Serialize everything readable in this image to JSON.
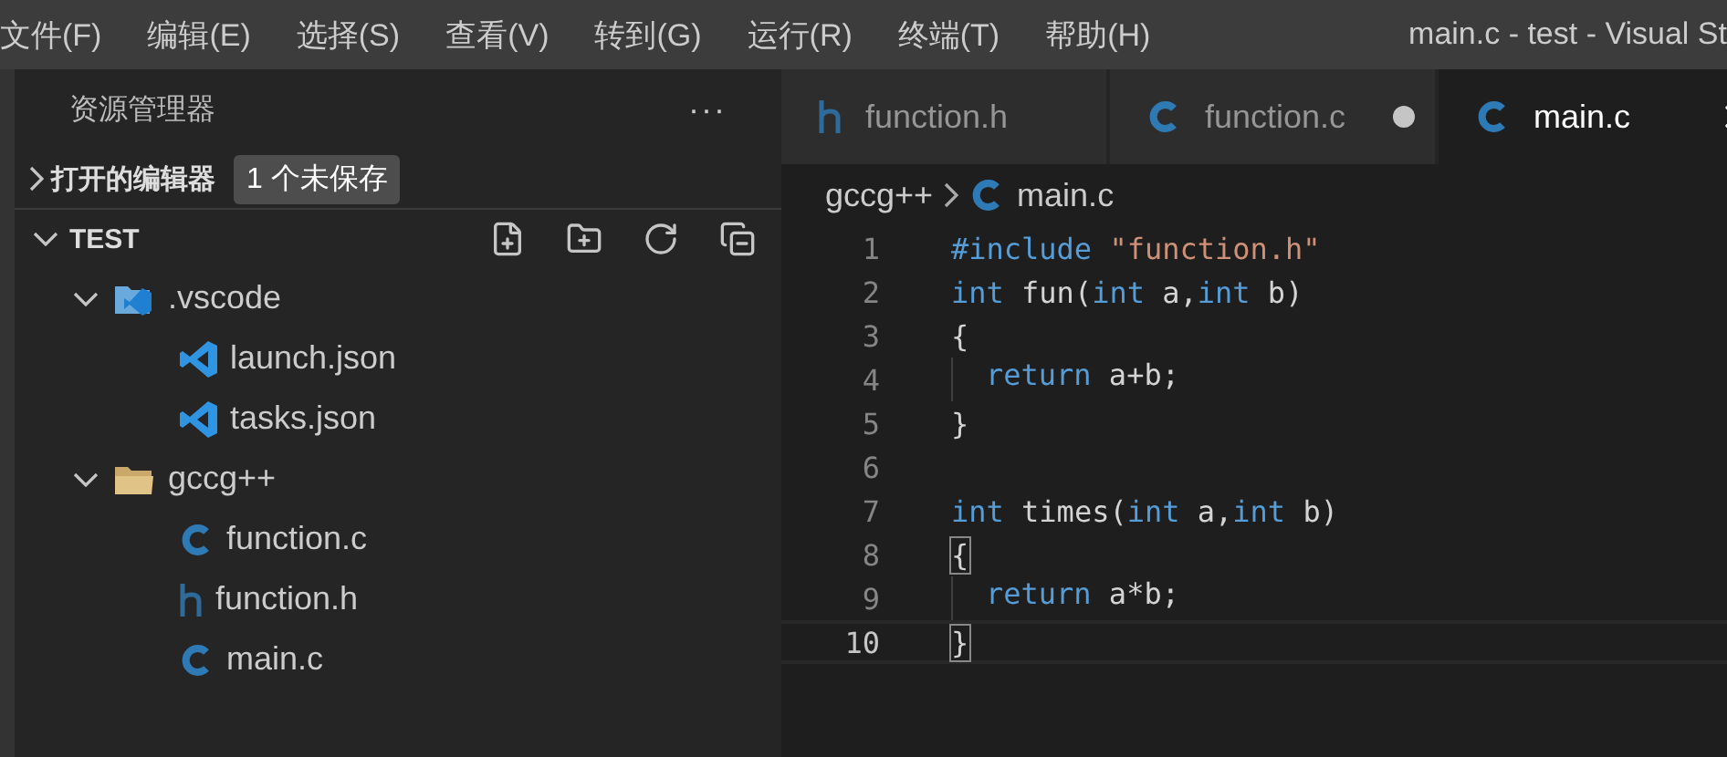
{
  "menu": [
    "文件(F)",
    "编辑(E)",
    "选择(S)",
    "查看(V)",
    "转到(G)",
    "运行(R)",
    "终端(T)",
    "帮助(H)"
  ],
  "window": {
    "title": "main.c - test - Visual St"
  },
  "explorer": {
    "title": "资源管理器",
    "more": "···",
    "sections": [
      {
        "title": "打开的编辑器",
        "expanded": false,
        "badge": "1 个未保存"
      },
      {
        "title": "TEST",
        "expanded": true
      }
    ],
    "tree": [
      {
        "name": ".vscode",
        "kind": "vscode-folder",
        "expanded": true,
        "children": [
          {
            "name": "launch.json",
            "kind": "vscode"
          },
          {
            "name": "tasks.json",
            "kind": "vscode"
          }
        ]
      },
      {
        "name": "gccg++",
        "kind": "folder",
        "expanded": true,
        "children": [
          {
            "name": "function.c",
            "kind": "c"
          },
          {
            "name": "function.h",
            "kind": "h"
          },
          {
            "name": "main.c",
            "kind": "c"
          }
        ]
      }
    ]
  },
  "tabs": [
    {
      "label": "function.h",
      "kind": "h",
      "selected": false,
      "dirty": false
    },
    {
      "label": "function.c",
      "kind": "c",
      "selected": false,
      "dirty": true
    },
    {
      "label": "main.c",
      "kind": "c",
      "selected": true,
      "dirty": false
    }
  ],
  "breadcrumb": [
    {
      "label": "gccg++",
      "kind": "folder"
    },
    {
      "label": "main.c",
      "kind": "c"
    }
  ],
  "code": [
    {
      "number": "1",
      "tokens": [
        {
          "text": "#include",
          "kind": "keyword"
        },
        {
          "text": " \"function.h\"",
          "kind": "string"
        }
      ]
    },
    {
      "number": "2",
      "tokens": [
        {
          "text": "int",
          "kind": "keyword"
        },
        {
          "text": " fun(",
          "kind": "plain"
        },
        {
          "text": "int",
          "kind": "keyword"
        },
        {
          "text": " a,",
          "kind": "plain"
        },
        {
          "text": "int",
          "kind": "keyword"
        },
        {
          "text": " b)",
          "kind": "plain"
        }
      ]
    },
    {
      "number": "3",
      "tokens": [
        {
          "text": "{",
          "kind": "plain"
        }
      ]
    },
    {
      "number": "4",
      "indent": true,
      "tokens": [
        {
          "text": "return",
          "kind": "keyword"
        },
        {
          "text": " a+b;",
          "kind": "plain"
        }
      ]
    },
    {
      "number": "5",
      "tokens": [
        {
          "text": "}",
          "kind": "plain"
        }
      ]
    },
    {
      "number": "6"
    },
    {
      "number": "7",
      "tokens": [
        {
          "text": "int",
          "kind": "keyword"
        },
        {
          "text": " times(",
          "kind": "plain"
        },
        {
          "text": "int",
          "kind": "keyword"
        },
        {
          "text": " a,",
          "kind": "plain"
        },
        {
          "text": "int",
          "kind": "keyword"
        },
        {
          "text": " b)",
          "kind": "plain"
        }
      ]
    },
    {
      "number": "8",
      "bracket_match": true,
      "tokens": [
        {
          "text": "{",
          "kind": "plain"
        }
      ]
    },
    {
      "number": "9",
      "indent": true,
      "tokens": [
        {
          "text": "return",
          "kind": "keyword"
        },
        {
          "text": " a*b;",
          "kind": "plain"
        }
      ]
    },
    {
      "number": "10",
      "bracket_match": true,
      "current": true,
      "tokens": [
        {
          "text": "}",
          "kind": "plain"
        }
      ]
    }
  ]
}
